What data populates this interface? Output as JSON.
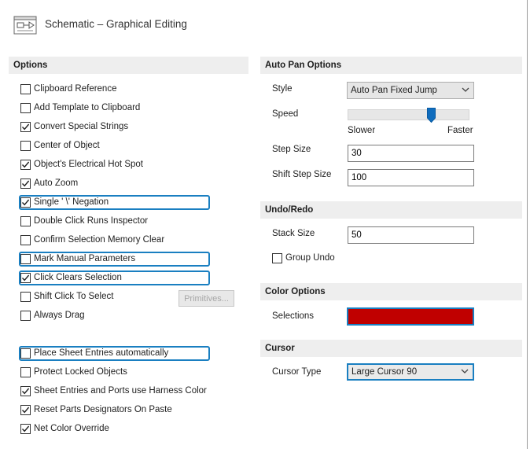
{
  "header": {
    "title": "Schematic – Graphical Editing",
    "icon": "schematic-icon"
  },
  "options": {
    "heading": "Options",
    "items": [
      {
        "label": "Clipboard Reference",
        "checked": false,
        "highlighted": false
      },
      {
        "label": "Add Template to Clipboard",
        "checked": false,
        "highlighted": false
      },
      {
        "label": "Convert Special Strings",
        "checked": true,
        "highlighted": false
      },
      {
        "label": "Center of Object",
        "checked": false,
        "highlighted": false
      },
      {
        "label": "Object's Electrical Hot Spot",
        "checked": true,
        "highlighted": false
      },
      {
        "label": "Auto Zoom",
        "checked": true,
        "highlighted": false
      },
      {
        "label": "Single ' \\' Negation",
        "checked": true,
        "highlighted": true
      },
      {
        "label": "Double Click Runs Inspector",
        "checked": false,
        "highlighted": false
      },
      {
        "label": "Confirm Selection Memory Clear",
        "checked": false,
        "highlighted": false
      },
      {
        "label": "Mark Manual Parameters",
        "checked": false,
        "highlighted": true
      },
      {
        "label": "Click Clears Selection",
        "checked": true,
        "highlighted": true
      },
      {
        "label": "Shift Click To Select",
        "checked": false,
        "highlighted": false
      },
      {
        "label": "Always Drag",
        "checked": false,
        "highlighted": false
      },
      {
        "label": "Place Sheet Entries automatically",
        "checked": false,
        "highlighted": true
      },
      {
        "label": "Protect Locked Objects",
        "checked": false,
        "highlighted": false
      },
      {
        "label": "Sheet Entries and Ports use Harness Color",
        "checked": true,
        "highlighted": false
      },
      {
        "label": "Reset Parts Designators On Paste",
        "checked": true,
        "highlighted": false
      },
      {
        "label": "Net Color Override",
        "checked": true,
        "highlighted": false
      }
    ],
    "primitives_button": "Primitives..."
  },
  "auto_pan": {
    "heading": "Auto Pan Options",
    "style_label": "Style",
    "style_value": "Auto Pan Fixed Jump",
    "speed_label": "Speed",
    "speed_slower": "Slower",
    "speed_faster": "Faster",
    "speed_level": 0.7,
    "step_size_label": "Step Size",
    "step_size_value": "30",
    "shift_step_size_label": "Shift Step Size",
    "shift_step_size_value": "100"
  },
  "undo_redo": {
    "heading": "Undo/Redo",
    "stack_size_label": "Stack Size",
    "stack_size_value": "50",
    "group_undo_label": "Group Undo",
    "group_undo_checked": false
  },
  "color_options": {
    "heading": "Color Options",
    "selections_label": "Selections",
    "selections_color": "#c00000"
  },
  "cursor": {
    "heading": "Cursor",
    "cursor_type_label": "Cursor Type",
    "cursor_type_value": "Large Cursor 90"
  },
  "colors": {
    "accent": "#1a7fc1",
    "section_bg": "#eeeeee",
    "selection_color": "#c00000"
  }
}
